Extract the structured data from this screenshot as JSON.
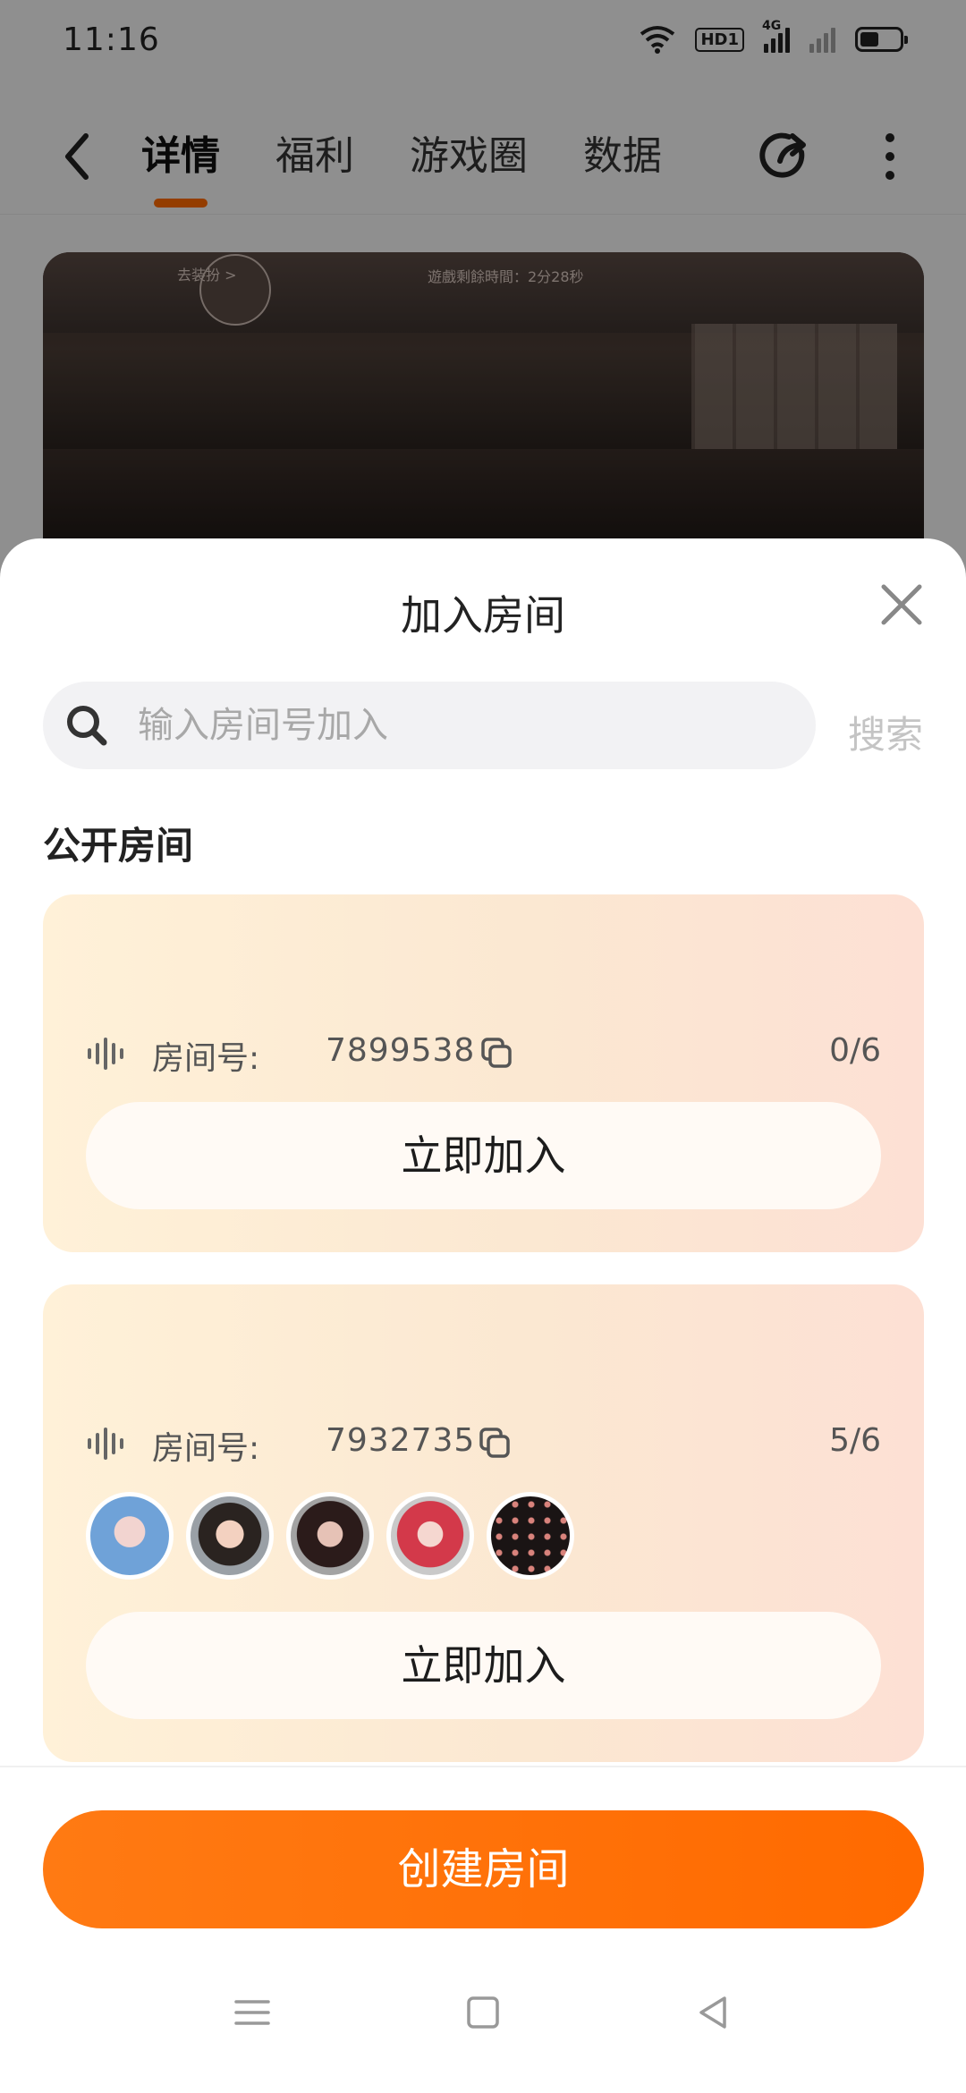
{
  "status_bar": {
    "time": "11:16",
    "network_label": "4G",
    "hd_label": "HD1"
  },
  "top_nav": {
    "tabs": [
      {
        "label": "详情",
        "active": true
      },
      {
        "label": "福利",
        "active": false
      },
      {
        "label": "游戏圈",
        "active": false
      },
      {
        "label": "数据",
        "active": false
      }
    ]
  },
  "video": {
    "timer_text": "遊戲剩餘時間：2分28秒",
    "goto_text": "去装扮 >"
  },
  "sheet": {
    "title": "加入房间",
    "search": {
      "placeholder": "输入房间号加入",
      "button_label": "搜索"
    },
    "section_title": "公开房间",
    "rooms": [
      {
        "label": "房间号:",
        "id": "7899538",
        "count": "0/6",
        "join_label": "立即加入",
        "avatars": []
      },
      {
        "label": "房间号:",
        "id": "7932735",
        "count": "5/6",
        "join_label": "立即加入",
        "avatars": [
          "blue-hair-anime-avatar",
          "brown-hair-anime-avatar",
          "dark-hair-glasses-avatar",
          "red-hair-anime-avatar",
          "polka-dot-avatar"
        ]
      }
    ],
    "create_label": "创建房间"
  },
  "colors": {
    "accent": "#ff6a00",
    "card_gradient_start": "#fff1d8",
    "card_gradient_end": "#fde0d4"
  }
}
